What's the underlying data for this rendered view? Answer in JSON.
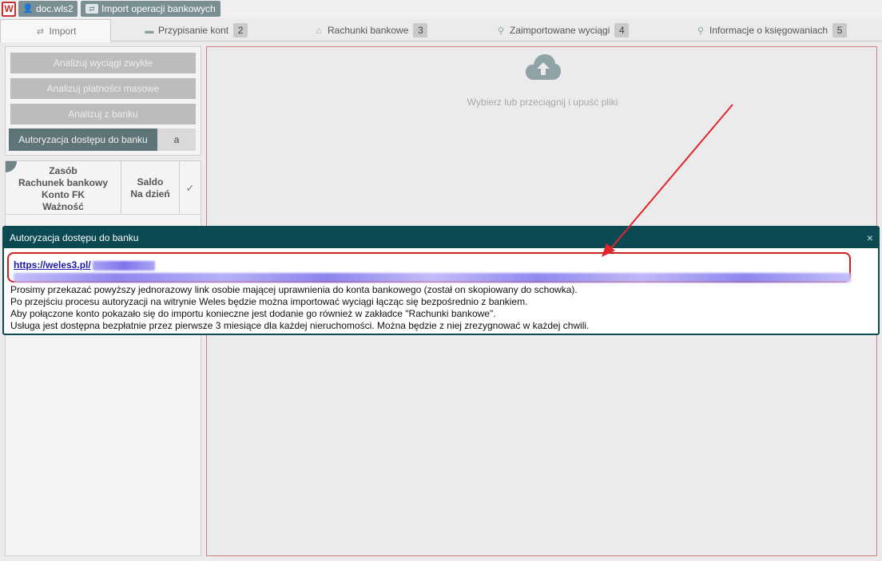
{
  "topbar": {
    "logo_letter": "W",
    "crumbs": [
      {
        "label": "doc.wls2",
        "icon": "user-icon"
      },
      {
        "label": "Import operacji bankowych",
        "icon": "transfer-icon"
      }
    ]
  },
  "tabs": [
    {
      "label": "Import",
      "icon": "swap-icon",
      "badge": ""
    },
    {
      "label": "Przypisanie kont",
      "icon": "folder-icon",
      "badge": "2"
    },
    {
      "label": "Rachunki bankowe",
      "icon": "bank-icon",
      "badge": "3"
    },
    {
      "label": "Zaimportowane wyciągi",
      "icon": "search-icon",
      "badge": "4"
    },
    {
      "label": "Informacje o księgowaniach",
      "icon": "search-icon",
      "badge": "5"
    }
  ],
  "left_panel": {
    "buttons": [
      "Analizuj wyciągi zwykłe",
      "Analizuj płatności masowe",
      "Analizuj z banku"
    ],
    "auth_button": "Autoryzacja dostępu do banku",
    "auth_side": "a"
  },
  "table": {
    "col1_lines": [
      "Zasób",
      "Rachunek bankowy",
      "Konto FK",
      "Ważność"
    ],
    "col2_lines": [
      "Saldo",
      "Na dzień"
    ],
    "col3_icon": "check-icon"
  },
  "upload": {
    "text": "Wybierz lub przeciągnij i upuść pliki",
    "icon": "cloud-upload-icon"
  },
  "modal": {
    "title": "Autoryzacja dostępu do banku",
    "close": "×",
    "link_text": "https://weles3.pl/",
    "messages": [
      "Prosimy przekazać powyższy jednorazowy link osobie mającej uprawnienia do konta bankowego (został on skopiowany do schowka).",
      "Po przejściu procesu autoryzacji na witrynie Weles będzie można importować wyciągi łącząc się bezpośrednio z bankiem.",
      "Aby połączone konto pokazało się do importu konieczne jest dodanie go również w zakładce \"Rachunki bankowe\".",
      "Usługa jest dostępna bezpłatnie przez pierwsze 3 miesiące dla każdej nieruchomości. Można będzie z niej zrezygnować w każdej chwili."
    ]
  },
  "colors": {
    "modal_header": "#0b4a53",
    "highlight": "#d21f1f",
    "auth_button": "#5f7478"
  }
}
